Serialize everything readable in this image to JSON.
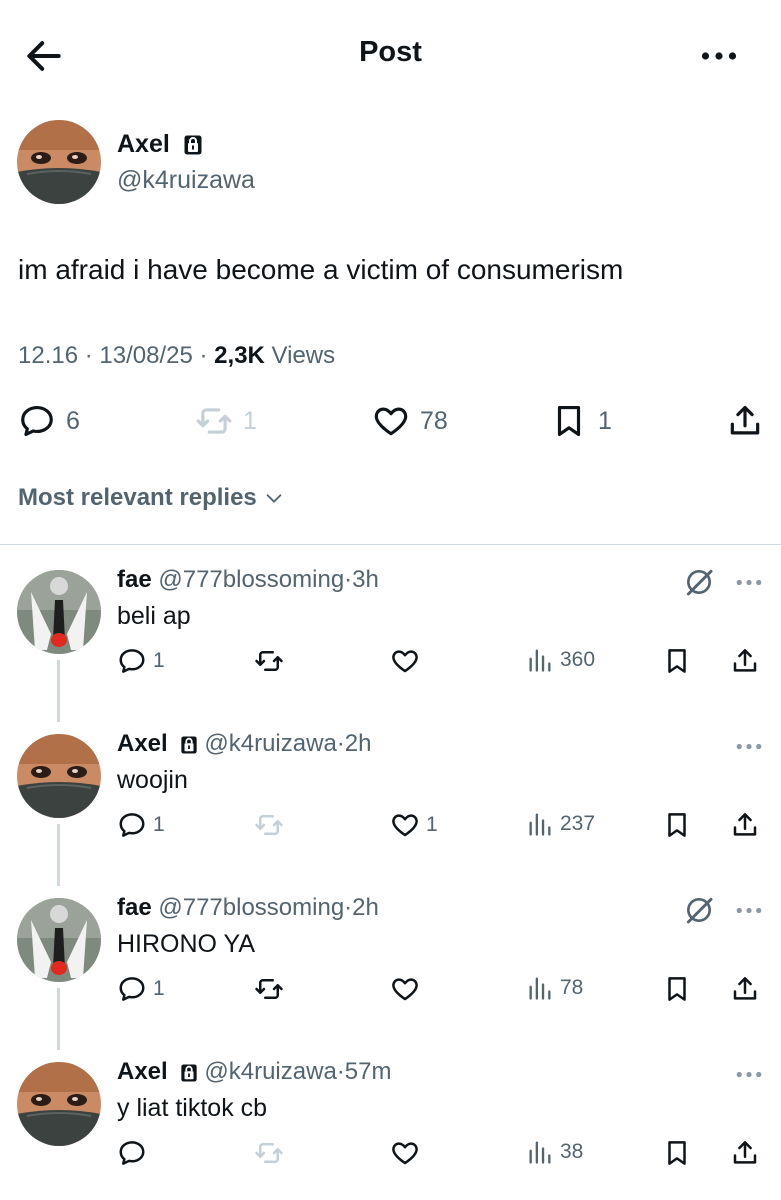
{
  "header": {
    "title": "Post"
  },
  "post": {
    "author_name": "Axel",
    "author_handle": "@k4ruizawa",
    "text": "im afraid i have become a victim of consumerism",
    "time": "12.16",
    "date": "13/08/25",
    "views_count": "2,3K",
    "views_label": "Views",
    "replies": "6",
    "reposts": "1",
    "likes": "78",
    "bookmarks": "1"
  },
  "sort_label": "Most relevant replies",
  "replies": [
    {
      "name": "fae",
      "handle": "@777blossoming",
      "age": "3h",
      "text": "beli ap",
      "replies": "1",
      "reposts": "",
      "likes": "",
      "views": "360",
      "grok": true
    },
    {
      "name": "Axel",
      "handle": "@k4ruizawa",
      "age": "2h",
      "text": "woojin",
      "replies": "1",
      "reposts": "",
      "likes": "1",
      "views": "237",
      "grok": false
    },
    {
      "name": "fae",
      "handle": "@777blossoming",
      "age": "2h",
      "text": "HIRONO YA",
      "replies": "1",
      "reposts": "",
      "likes": "",
      "views": "78",
      "grok": true
    },
    {
      "name": "Axel",
      "handle": "@k4ruizawa",
      "age": "57m",
      "text": "y liat tiktok cb",
      "replies": "",
      "reposts": "",
      "likes": "",
      "views": "38",
      "grok": false
    }
  ],
  "separator": "·",
  "icons": [
    "back-arrow-icon",
    "more-icon",
    "lock-icon",
    "reply-icon",
    "repost-icon",
    "like-icon",
    "bookmark-icon",
    "share-icon",
    "views-icon",
    "grok-icon",
    "chevron-down-icon"
  ],
  "colors": {
    "text": "#0f1419",
    "muted": "#536471",
    "faint": "#c4cfd6",
    "divider": "#cfd9de"
  }
}
